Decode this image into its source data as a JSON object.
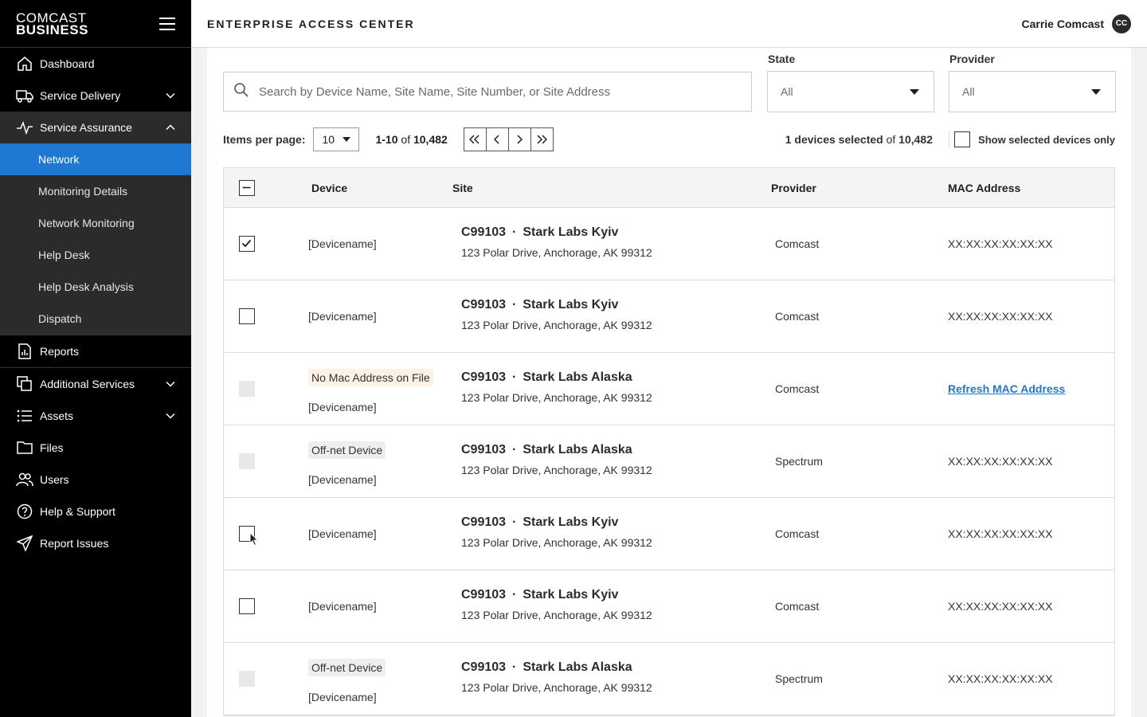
{
  "brand": {
    "line1": "COMCAST",
    "line2": "BUSINESS"
  },
  "app_title": "ENTERPRISE ACCESS CENTER",
  "user": {
    "name": "Carrie Comcast",
    "initials": "CC"
  },
  "sidebar": {
    "items": [
      {
        "label": "Dashboard",
        "icon": "home-icon"
      },
      {
        "label": "Service Delivery",
        "icon": "truck-icon",
        "chevron": "down"
      },
      {
        "label": "Service Assurance",
        "icon": "pulse-icon",
        "chevron": "up"
      }
    ],
    "sub_items": [
      {
        "label": "Network",
        "active": true
      },
      {
        "label": "Monitoring Details"
      },
      {
        "label": "Network Monitoring"
      },
      {
        "label": "Help Desk"
      },
      {
        "label": "Help Desk Analysis"
      },
      {
        "label": "Dispatch"
      }
    ],
    "items_after": [
      {
        "label": "Reports",
        "icon": "report-icon"
      },
      {
        "label": "Additional Services",
        "icon": "copy-icon",
        "chevron": "down"
      },
      {
        "label": "Assets",
        "icon": "list-icon",
        "chevron": "down"
      },
      {
        "label": "Files",
        "icon": "folder-icon"
      },
      {
        "label": "Users",
        "icon": "users-icon"
      },
      {
        "label": "Help & Support",
        "icon": "help-icon"
      },
      {
        "label": "Report Issues",
        "icon": "send-icon"
      }
    ]
  },
  "search": {
    "placeholder": "Search by Device Name, Site Name, Site Number, or Site Address",
    "value": ""
  },
  "filters": {
    "state": {
      "label": "State",
      "value": "All"
    },
    "provider": {
      "label": "Provider",
      "value": "All"
    }
  },
  "pagination": {
    "items_per_page_label": "Items per page:",
    "items_per_page": "10",
    "range": "1-10",
    "of": "of",
    "total": "10,482",
    "selected_count": "1 devices selected",
    "selected_of": "of",
    "selected_total": "10,482",
    "show_selected_label": "Show selected devices only"
  },
  "table": {
    "headers": {
      "device": "Device",
      "site": "Site",
      "provider": "Provider",
      "mac": "MAC Address"
    },
    "rows": [
      {
        "checkbox": "checked",
        "tag": "",
        "device": "[Devicename]",
        "site_number": "C99103",
        "sep": "·",
        "site_name": "Stark Labs Kyiv",
        "address": "123 Polar Drive, Anchorage, AK 99312",
        "provider": "Comcast",
        "mac": "XX:XX:XX:XX:XX:XX"
      },
      {
        "checkbox": "unchecked",
        "tag": "",
        "device": "[Devicename]",
        "site_number": "C99103",
        "sep": "·",
        "site_name": "Stark Labs Kyiv",
        "address": "123 Polar Drive, Anchorage, AK 99312",
        "provider": "Comcast",
        "mac": "XX:XX:XX:XX:XX:XX"
      },
      {
        "checkbox": "disabled",
        "tag": "No Mac Address on File",
        "tag_style": "warn",
        "device": "[Devicename]",
        "site_number": "C99103",
        "sep": "·",
        "site_name": "Stark Labs Alaska",
        "address": "123 Polar Drive, Anchorage, AK 99312",
        "provider": "Comcast",
        "mac": "Refresh MAC Address",
        "mac_is_link": true
      },
      {
        "checkbox": "disabled",
        "tag": "Off-net Device",
        "tag_style": "neutral",
        "device": "[Devicename]",
        "site_number": "C99103",
        "sep": "·",
        "site_name": "Stark Labs Alaska",
        "address": "123 Polar Drive, Anchorage, AK 99312",
        "provider": "Spectrum",
        "mac": "XX:XX:XX:XX:XX:XX"
      },
      {
        "checkbox": "unchecked",
        "tag": "",
        "device": "[Devicename]",
        "site_number": "C99103",
        "sep": "·",
        "site_name": "Stark Labs Kyiv",
        "address": "123 Polar Drive, Anchorage, AK 99312",
        "provider": "Comcast",
        "mac": "XX:XX:XX:XX:XX:XX"
      },
      {
        "checkbox": "unchecked",
        "tag": "",
        "device": "[Devicename]",
        "site_number": "C99103",
        "sep": "·",
        "site_name": "Stark Labs Kyiv",
        "address": "123 Polar Drive, Anchorage, AK 99312",
        "provider": "Comcast",
        "mac": "XX:XX:XX:XX:XX:XX"
      },
      {
        "checkbox": "disabled",
        "tag": "Off-net Device",
        "tag_style": "neutral",
        "device": "[Devicename]",
        "site_number": "C99103",
        "sep": "·",
        "site_name": "Stark Labs Alaska",
        "address": "123 Polar Drive, Anchorage, AK 99312",
        "provider": "Spectrum",
        "mac": "XX:XX:XX:XX:XX:XX"
      }
    ]
  },
  "colors": {
    "accent": "#1f78d1",
    "sidebar_bg": "#000000",
    "submenu_bg": "#2b2b2b",
    "warn_tag_bg": "#fdf1e3"
  }
}
